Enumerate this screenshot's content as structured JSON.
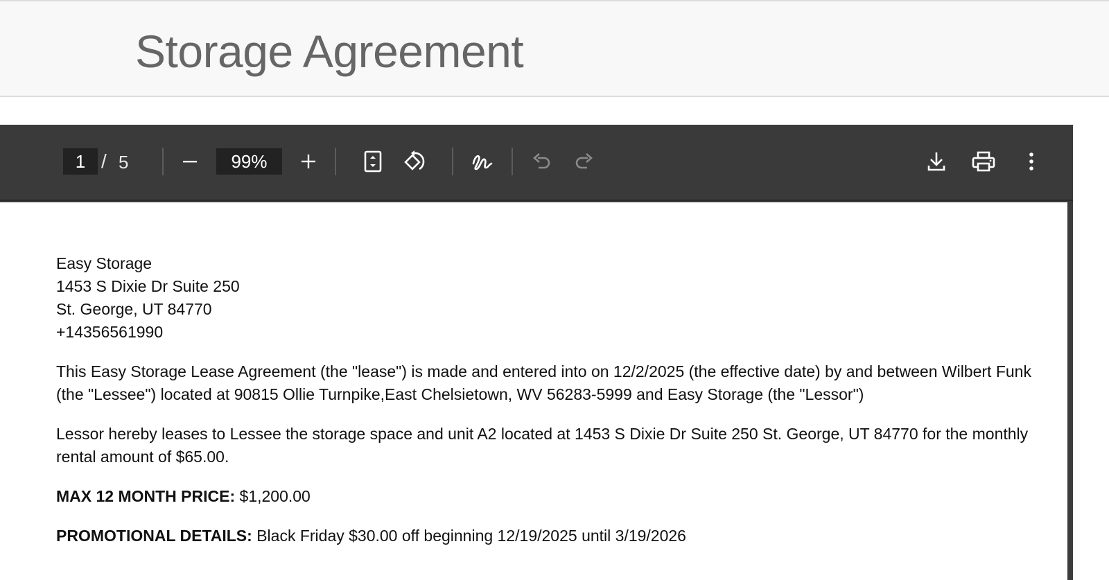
{
  "page": {
    "title": "Storage Agreement"
  },
  "toolbar": {
    "current_page": "1",
    "page_separator": "/",
    "total_pages": "5",
    "zoom": "99%"
  },
  "document": {
    "address": [
      "Easy Storage",
      "1453 S Dixie Dr Suite 250",
      "St. George, UT 84770",
      "+14356561990"
    ],
    "paragraphs": [
      "This Easy Storage Lease Agreement (the \"lease\") is made and entered into on 12/2/2025 (the effective date) by and between Wilbert Funk (the \"Lessee\") located at 90815 Ollie Turnpike,East Chelsietown, WV 56283-5999 and Easy Storage (the \"Lessor\")",
      "Lessor hereby leases to Lessee the storage space and unit A2 located at 1453 S Dixie Dr Suite 250 St. George, UT 84770 for the monthly rental amount of $65.00."
    ],
    "max_price": {
      "label": "MAX 12 MONTH PRICE:",
      "value": "$1,200.00"
    },
    "promo": {
      "label": "PROMOTIONAL DETAILS:",
      "value": "Black Friday $30.00 off beginning 12/19/2025 until 3/19/2026"
    }
  },
  "icons": {
    "zoom_out": "minus-icon",
    "zoom_in": "plus-icon",
    "fit": "fit-to-page-icon",
    "rotate": "rotate-icon",
    "draw": "draw-icon",
    "undo": "undo-icon",
    "redo": "redo-icon",
    "download": "download-icon",
    "print": "print-icon",
    "more": "more-vertical-icon"
  }
}
